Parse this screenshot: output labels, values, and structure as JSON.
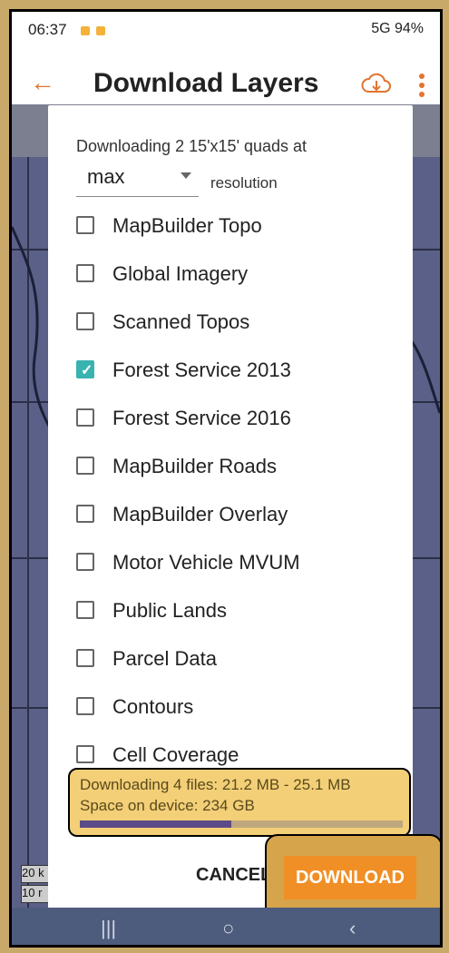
{
  "status": {
    "time": "06:37",
    "right": "5G 94%"
  },
  "header": {
    "title": "Download Layers"
  },
  "dialog": {
    "info": "Downloading 2 15'x15' quads at",
    "resolution_value": "max",
    "resolution_label": "resolution",
    "layers": [
      {
        "label": "MapBuilder Topo",
        "checked": false
      },
      {
        "label": "Global Imagery",
        "checked": false
      },
      {
        "label": "Scanned Topos",
        "checked": false
      },
      {
        "label": "Forest Service 2013",
        "checked": true
      },
      {
        "label": "Forest Service 2016",
        "checked": false
      },
      {
        "label": "MapBuilder Roads",
        "checked": false
      },
      {
        "label": "MapBuilder Overlay",
        "checked": false
      },
      {
        "label": "Motor Vehicle MVUM",
        "checked": false
      },
      {
        "label": "Public Lands",
        "checked": false
      },
      {
        "label": "Parcel Data",
        "checked": false
      },
      {
        "label": "Contours",
        "checked": false
      },
      {
        "label": "Cell Coverage",
        "checked": false
      }
    ],
    "download_summary": "Downloading 4 files: 21.2 MB - 25.1 MB",
    "space": "Space on device: 234 GB",
    "progress_fraction": 0.47,
    "cancel_label": "CANCEL",
    "download_label": "DOWNLOAD"
  },
  "map": {
    "scale_labels": [
      "20 k",
      "10 r"
    ]
  },
  "icons": {
    "back": "back-arrow-icon",
    "cloud": "cloud-download-icon",
    "menu": "more-vert-icon"
  },
  "colors": {
    "accent": "#f08f26",
    "checked": "#39b3b0",
    "highlight": "#f3cf77"
  }
}
